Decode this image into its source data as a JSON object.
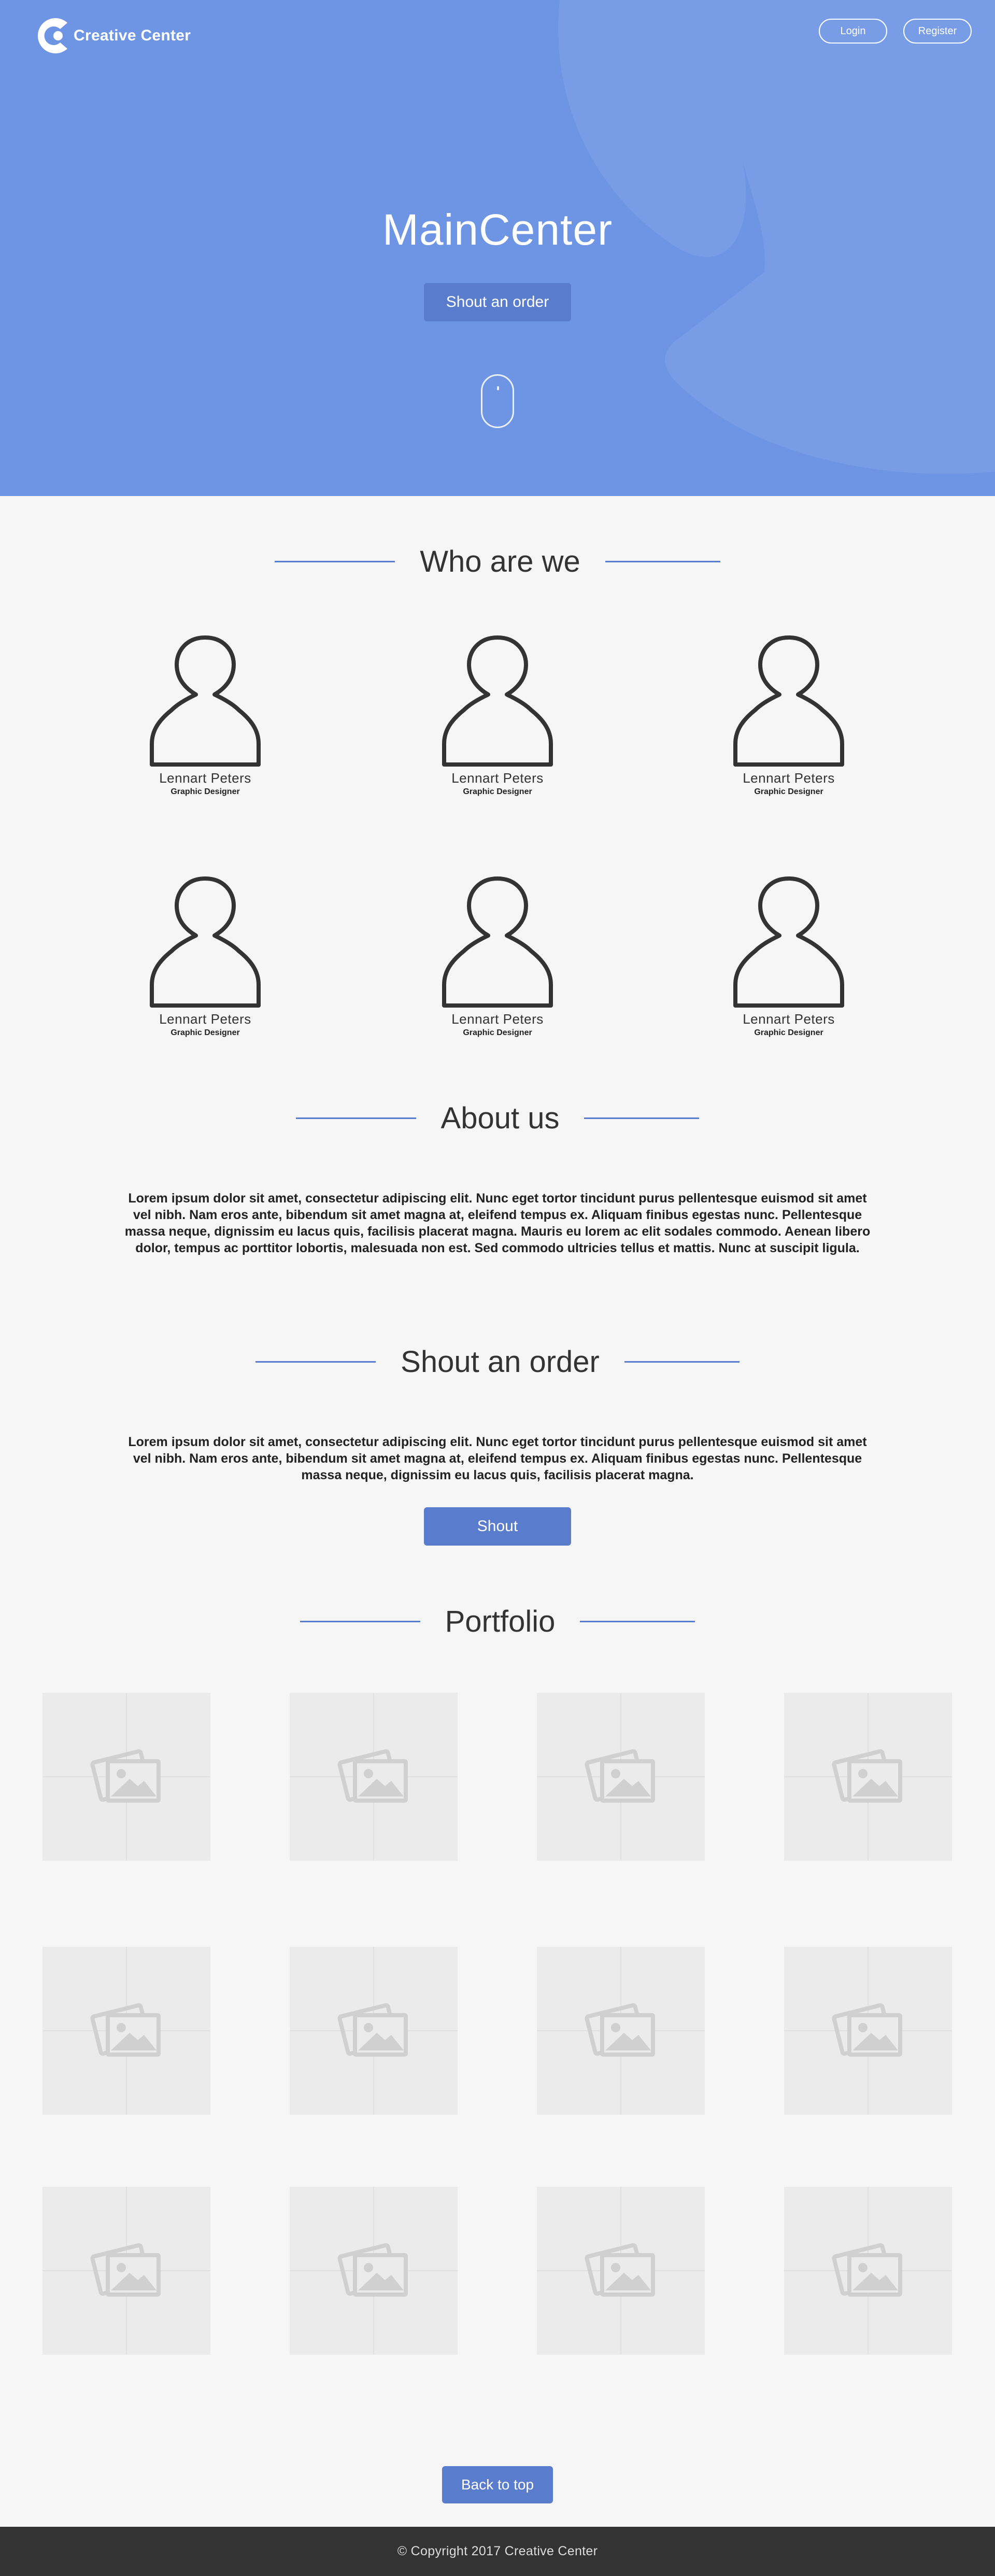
{
  "header": {
    "logo_text": "Creative Center",
    "login_label": "Login",
    "register_label": "Register"
  },
  "hero": {
    "title": "MainCenter",
    "cta_label": "Shout an order"
  },
  "who": {
    "title": "Who are we",
    "members": [
      {
        "name": "Lennart Peters",
        "role": "Graphic Designer"
      },
      {
        "name": "Lennart Peters",
        "role": "Graphic Designer"
      },
      {
        "name": "Lennart Peters",
        "role": "Graphic Designer"
      },
      {
        "name": "Lennart Peters",
        "role": "Graphic Designer"
      },
      {
        "name": "Lennart Peters",
        "role": "Graphic Designer"
      },
      {
        "name": "Lennart Peters",
        "role": "Graphic Designer"
      }
    ]
  },
  "about": {
    "title": "About us",
    "text": "Lorem ipsum dolor sit amet, consectetur adipiscing elit. Nunc eget tortor tincidunt purus pellentesque euismod sit amet vel nibh. Nam eros ante, bibendum sit amet magna at, eleifend tempus ex. Aliquam finibus egestas nunc. Pellentesque massa neque, dignissim eu lacus quis, facilisis placerat magna. Mauris eu lorem ac elit sodales commodo. Aenean libero dolor, tempus ac porttitor lobortis, malesuada non est. Sed commodo ultricies tellus et mattis. Nunc at suscipit ligula."
  },
  "order": {
    "title": "Shout an order",
    "text": "Lorem ipsum dolor sit amet, consectetur adipiscing elit. Nunc eget tortor tincidunt purus pellentesque euismod sit amet vel nibh. Nam eros ante, bibendum sit amet magna at, eleifend tempus ex. Aliquam finibus egestas nunc. Pellentesque massa neque, dignissim eu lacus quis, facilisis placerat magna.",
    "button_label": "Shout"
  },
  "portfolio": {
    "title": "Portfolio",
    "item_icon": "image-placeholder-icon",
    "item_count": 12
  },
  "back_to_top_label": "Back to top",
  "footer": {
    "copyright": "© Copyright 2017 Creative Center"
  },
  "colors": {
    "hero_bg": "#6e94e4",
    "accent": "#5a7ccc",
    "page_bg": "#f6f6f6",
    "footer_bg": "#333333"
  }
}
